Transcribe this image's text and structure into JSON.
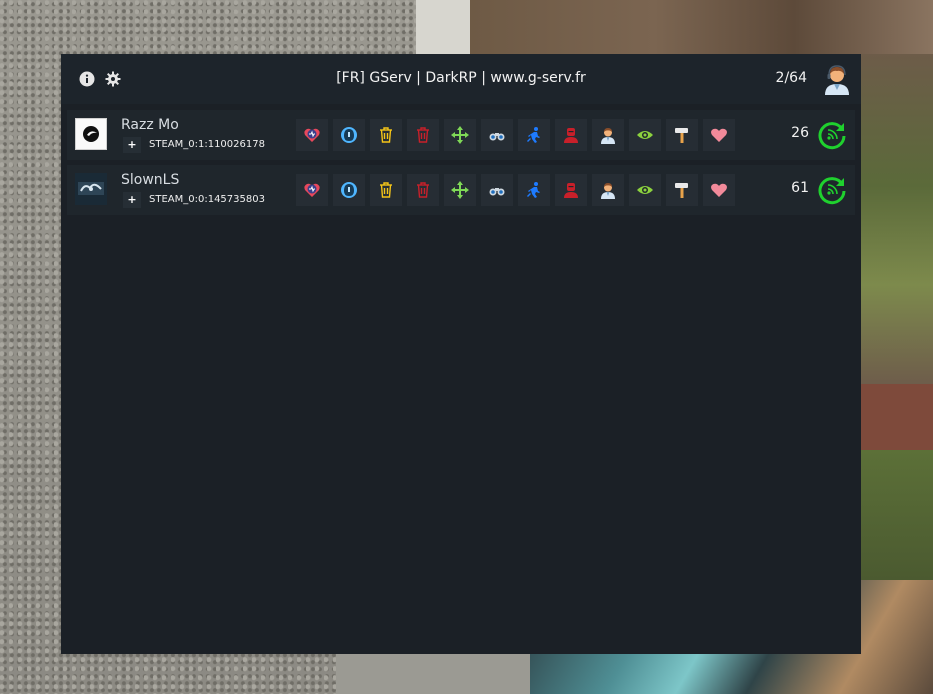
{
  "header": {
    "title": "[FR] GServ | DarkRP | www.g-serv.fr",
    "player_count": "2/64",
    "left_icons": [
      "info-icon",
      "gear-icon"
    ],
    "right_icon": "support-agent-icon"
  },
  "actions": [
    {
      "name": "heal-icon",
      "color": "#e8485c"
    },
    {
      "name": "cloak-icon",
      "color": "#4fb6ff"
    },
    {
      "name": "trash-yellow-icon",
      "color": "#f5c518"
    },
    {
      "name": "trash-red-icon",
      "color": "#c8202a"
    },
    {
      "name": "move-icon",
      "color": "#7fd957"
    },
    {
      "name": "binoculars-icon",
      "color": "#cfd8e0"
    },
    {
      "name": "runner-icon",
      "color": "#1e7bff"
    },
    {
      "name": "jail-man-icon",
      "color": "#c8202a"
    },
    {
      "name": "person-icon",
      "color": "#f2b27a"
    },
    {
      "name": "eye-icon",
      "color": "#8bd13e"
    },
    {
      "name": "hammer-icon",
      "color": "#e8a24a"
    },
    {
      "name": "heart-icon",
      "color": "#f28a9a"
    }
  ],
  "players": [
    {
      "name": "Razz Mo",
      "steam_id": "STEAM_0:1:110026178",
      "ping": "26",
      "expand_label": "+",
      "avatar_icon": "round-logo-avatar",
      "status_icon": "refresh-icon"
    },
    {
      "name": "SlownLS",
      "steam_id": "STEAM_0:0:145735803",
      "ping": "61",
      "expand_label": "+",
      "avatar_icon": "dark-logo-avatar",
      "status_icon": "refresh-icon"
    }
  ]
}
